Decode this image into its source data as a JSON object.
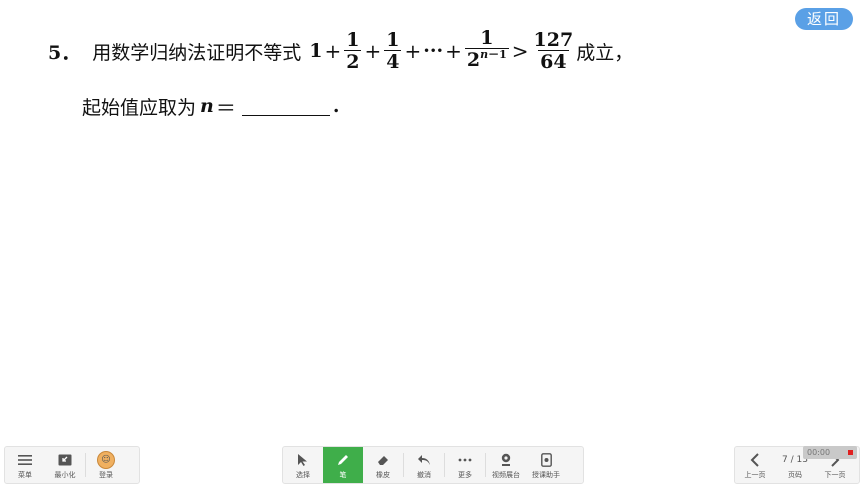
{
  "back_button": {
    "label": "返回"
  },
  "question": {
    "number": "5．",
    "lead": "用数学归纳法证明不等式",
    "one": "1",
    "plus": "+",
    "frac1": {
      "num": "1",
      "den": "2"
    },
    "frac2": {
      "num": "1",
      "den": "4"
    },
    "ellipsis": "···",
    "frac3": {
      "num": "1",
      "den_base": "2",
      "den_exp_var": "n",
      "den_exp_rest": "－1"
    },
    "gt": ">",
    "frac4": {
      "num": "127",
      "den": "64"
    },
    "tail": "成立，",
    "line2_text": "起始值应取为",
    "var_n": "n",
    "eq": "＝",
    "period": "."
  },
  "toolbar_left": [
    {
      "label": "菜单",
      "icon": "menu-icon"
    },
    {
      "label": "最小化",
      "icon": "minimize-icon"
    },
    {
      "label": "登录",
      "icon": "avatar-icon"
    }
  ],
  "toolbar_mid": [
    {
      "label": "选择",
      "icon": "cursor-icon"
    },
    {
      "label": "笔",
      "icon": "pen-icon"
    },
    {
      "label": "橡皮",
      "icon": "eraser-icon"
    },
    {
      "label": "撤消",
      "icon": "undo-icon"
    },
    {
      "label": "更多",
      "icon": "more-icon"
    },
    {
      "label": "视频展台",
      "icon": "camera-icon"
    },
    {
      "label": "授课助手",
      "icon": "assistant-icon"
    }
  ],
  "toolbar_right": [
    {
      "label": "上一页",
      "icon": "chevron-left-icon"
    },
    {
      "label": "页码",
      "value": "7 / 13"
    },
    {
      "label": "下一页",
      "icon": "chevron-right-icon"
    }
  ],
  "recorder": {
    "time": "00:00"
  },
  "colors": {
    "accent_green": "#3fae4a",
    "back_blue": "#5aa0e6"
  }
}
